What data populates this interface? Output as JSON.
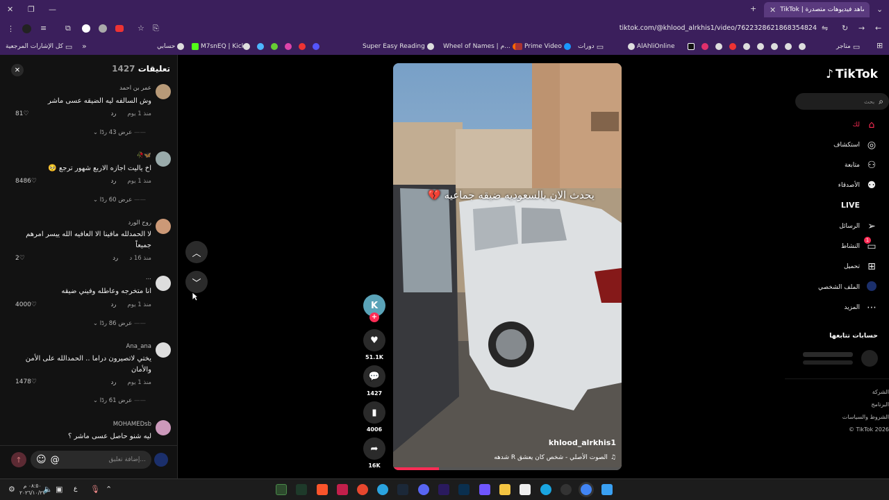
{
  "browser": {
    "tab_title": "TikTok | شاهد فيديوهات متصدرة",
    "url": "tiktok.com/@khlood_alrkhis1/video/7622328621868354824",
    "bookmarks": [
      "كل الإشارات المرجعية",
      "حسابي",
      "M7snEQ | Kick",
      "Super Easy Reading",
      "Wheel of Names | م...",
      "Prime Video",
      "دورات",
      "AlAhliOnline",
      "متاجر"
    ]
  },
  "comments_panel": {
    "title": "تعليقات",
    "count": "1427",
    "items": [
      {
        "user": "عمر بن احمد",
        "text": "وش السالفه ليه الضيقه عسى ماشر",
        "time": "منذ 1 يوم",
        "reply": "رد",
        "likes": "81",
        "replies": "عرض 43 ردًا"
      },
      {
        "user": "🦋🥀",
        "text": "اخ ياليت اجازه الاربع شهور ترجع 🥺",
        "time": "منذ 1 يوم",
        "reply": "رد",
        "likes": "8486",
        "replies": "عرض 60 ردًا"
      },
      {
        "user": "روح الورد",
        "text": "لا الحمدلله مافينا الا العافيه الله ييسر امرهم جميعاً",
        "time": "منذ 16 د",
        "reply": "رد",
        "likes": "2",
        "replies": ""
      },
      {
        "user": "...",
        "text": "انا متخرجه وعاطله وفيني ضيقه",
        "time": "منذ 1 يوم",
        "reply": "رد",
        "likes": "4000",
        "replies": "عرض 86 ردًا"
      },
      {
        "user": "Ana_ana",
        "text": "يختي لاتصيرون دراما .. الحمدالله على الأمن والأمان",
        "time": "منذ 1 يوم",
        "reply": "رد",
        "likes": "1478",
        "replies": "عرض 61 ردًا"
      },
      {
        "user": "MOHAMEDsb",
        "text": "ليه شنو حاصل عسى ماشر ؟",
        "time": "",
        "reply": "",
        "likes": "",
        "replies": ""
      }
    ],
    "input_placeholder": "إضافة تعليق..."
  },
  "video": {
    "caption": "يحدث الان بالسعوديه ضيقه جماعيه 💔",
    "author": "khlood_alrkhis1",
    "sound": "الصوت الأصلي - شخص كان يعشق R شدهه",
    "likes": "51.1K",
    "comments": "1427",
    "saves": "4006",
    "shares": "16K",
    "progress": 0.2
  },
  "nav": {
    "logo": "TikTok",
    "search_placeholder": "بحث",
    "items": [
      "لك",
      "استكشاف",
      "متابعة",
      "الأصدقاء",
      "LIVE",
      "الرسائل",
      "النشاط",
      "تحميل",
      "الملف الشخصي",
      "المزيد"
    ],
    "activity_badge": "1",
    "following_title": "حسابات تتابعها",
    "footer": [
      "الشركة",
      "البرنامج",
      "الشروط والسياسات",
      "© TikTok 2026"
    ]
  },
  "taskbar": {
    "time": "٠٨:٥٠ م",
    "date": "٢٠٢٦/١٠/٢٧",
    "lang": "ع"
  },
  "colors": {
    "accent": "#fe2c55",
    "browser": "#3b1f5c",
    "panel": "#121212"
  }
}
